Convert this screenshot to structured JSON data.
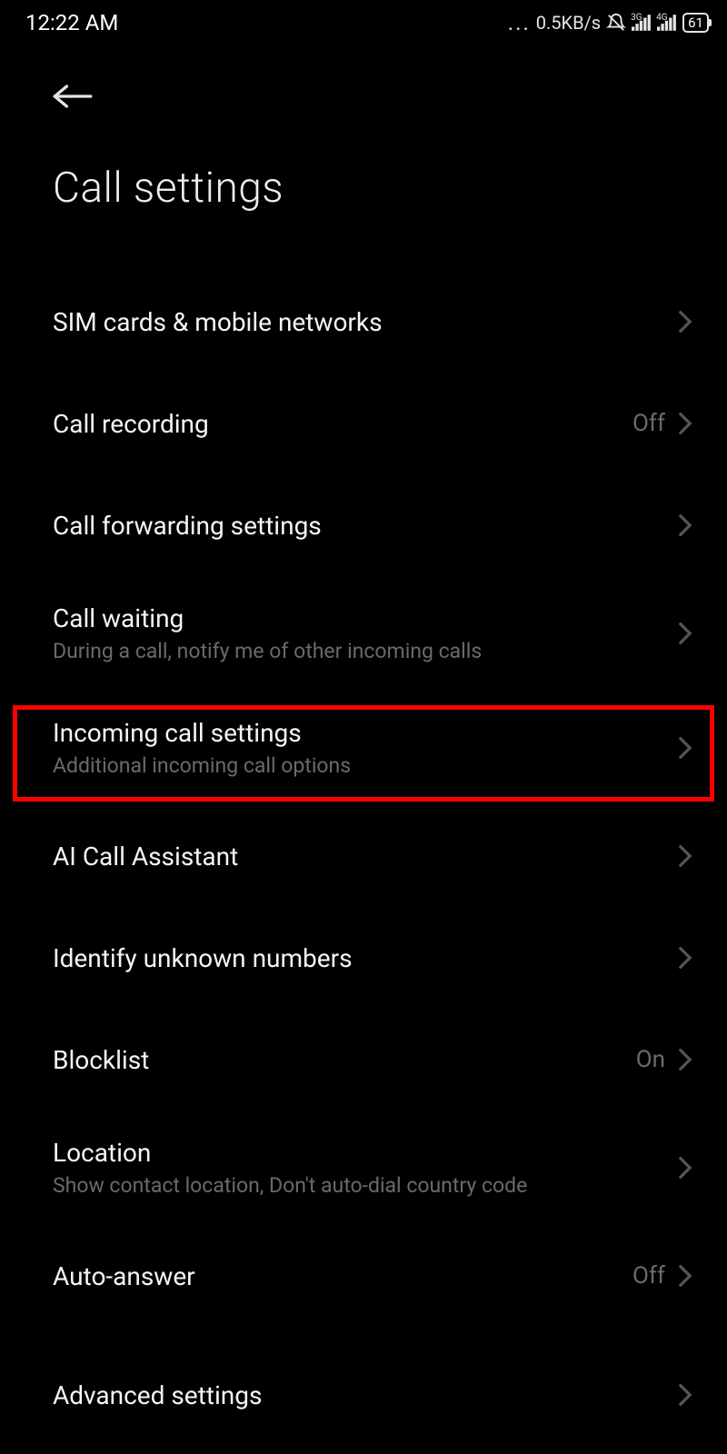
{
  "status": {
    "time": "12:22 AM",
    "speed": "0.5KB/s",
    "net1_label": "3G",
    "net2_label": "4G",
    "battery": "61"
  },
  "header": {
    "title": "Call settings"
  },
  "items": {
    "sim": {
      "title": "SIM cards & mobile networks"
    },
    "recording": {
      "title": "Call recording",
      "value": "Off"
    },
    "forwarding": {
      "title": "Call forwarding settings"
    },
    "waiting": {
      "title": "Call waiting",
      "subtitle": "During a call, notify me of other incoming calls"
    },
    "incoming": {
      "title": "Incoming call settings",
      "subtitle": "Additional incoming call options"
    },
    "ai": {
      "title": "AI Call Assistant"
    },
    "identify": {
      "title": "Identify unknown numbers"
    },
    "blocklist": {
      "title": "Blocklist",
      "value": "On"
    },
    "location": {
      "title": "Location",
      "subtitle": "Show contact location, Don't auto-dial country code"
    },
    "autoanswer": {
      "title": "Auto-answer",
      "value": "Off"
    },
    "advanced": {
      "title": "Advanced settings"
    }
  }
}
